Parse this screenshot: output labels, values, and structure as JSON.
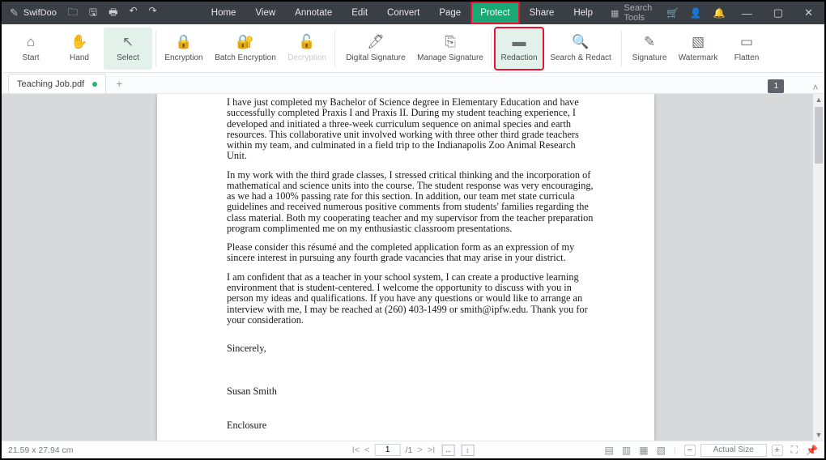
{
  "brand": {
    "name": "SwifDoo"
  },
  "menu": {
    "items": [
      "Home",
      "View",
      "Annotate",
      "Edit",
      "Convert",
      "Page",
      "Protect",
      "Share",
      "Help"
    ],
    "active": "Protect",
    "search_label": "Search Tools"
  },
  "ribbon": {
    "start": "Start",
    "hand": "Hand",
    "select": "Select",
    "encryption": "Encryption",
    "batch_encryption": "Batch Encryption",
    "decryption": "Decryption",
    "digital_signature": "Digital Signature",
    "manage_signature": "Manage Signature",
    "redaction": "Redaction",
    "search_redact": "Search & Redact",
    "signature": "Signature",
    "watermark": "Watermark",
    "flatten": "Flatten"
  },
  "tab": {
    "filename": "Teaching Job.pdf"
  },
  "page_indicator": "1",
  "document": {
    "p1": "I have just completed my Bachelor of Science degree in Elementary Education and have successfully completed Praxis I and Praxis II. During my student teaching experience, I developed and initiated a three-week curriculum sequence on animal species and earth resources. This collaborative unit involved working with three other third grade teachers within my team, and culminated in a field trip to the Indianapolis Zoo Animal Research Unit.",
    "p2": "In my work with the third grade classes, I stressed critical thinking and the incorporation of mathematical and science units into the course.  The student response was very encouraging, as we had a 100% passing rate for this section.  In addition, our team met state curricula guidelines and received numerous positive comments from students' families regarding the class material. Both my cooperating teacher and my supervisor from the teacher preparation program complimented me on my enthusiastic classroom presentations.",
    "p3": "Please consider this résumé and the completed application form as an expression of my sincere interest in pursuing any fourth grade vacancies that may arise in your district.",
    "p4": "I am confident that as a teacher in your school system, I can create a productive learning environment that is student-centered. I welcome the opportunity to discuss with you in person my ideas and qualifications. If you have any questions or would like to arrange an interview with me, I may be reached at (260) 403-1499 or smith@ipfw.edu. Thank you for your consideration.",
    "closing": "Sincerely,",
    "signature": "Susan Smith",
    "enclosure": "Enclosure"
  },
  "status": {
    "dimensions": "21.59 x 27.94 cm",
    "current_page": "1",
    "total_pages": "/1",
    "zoom_label": "Actual Size"
  }
}
